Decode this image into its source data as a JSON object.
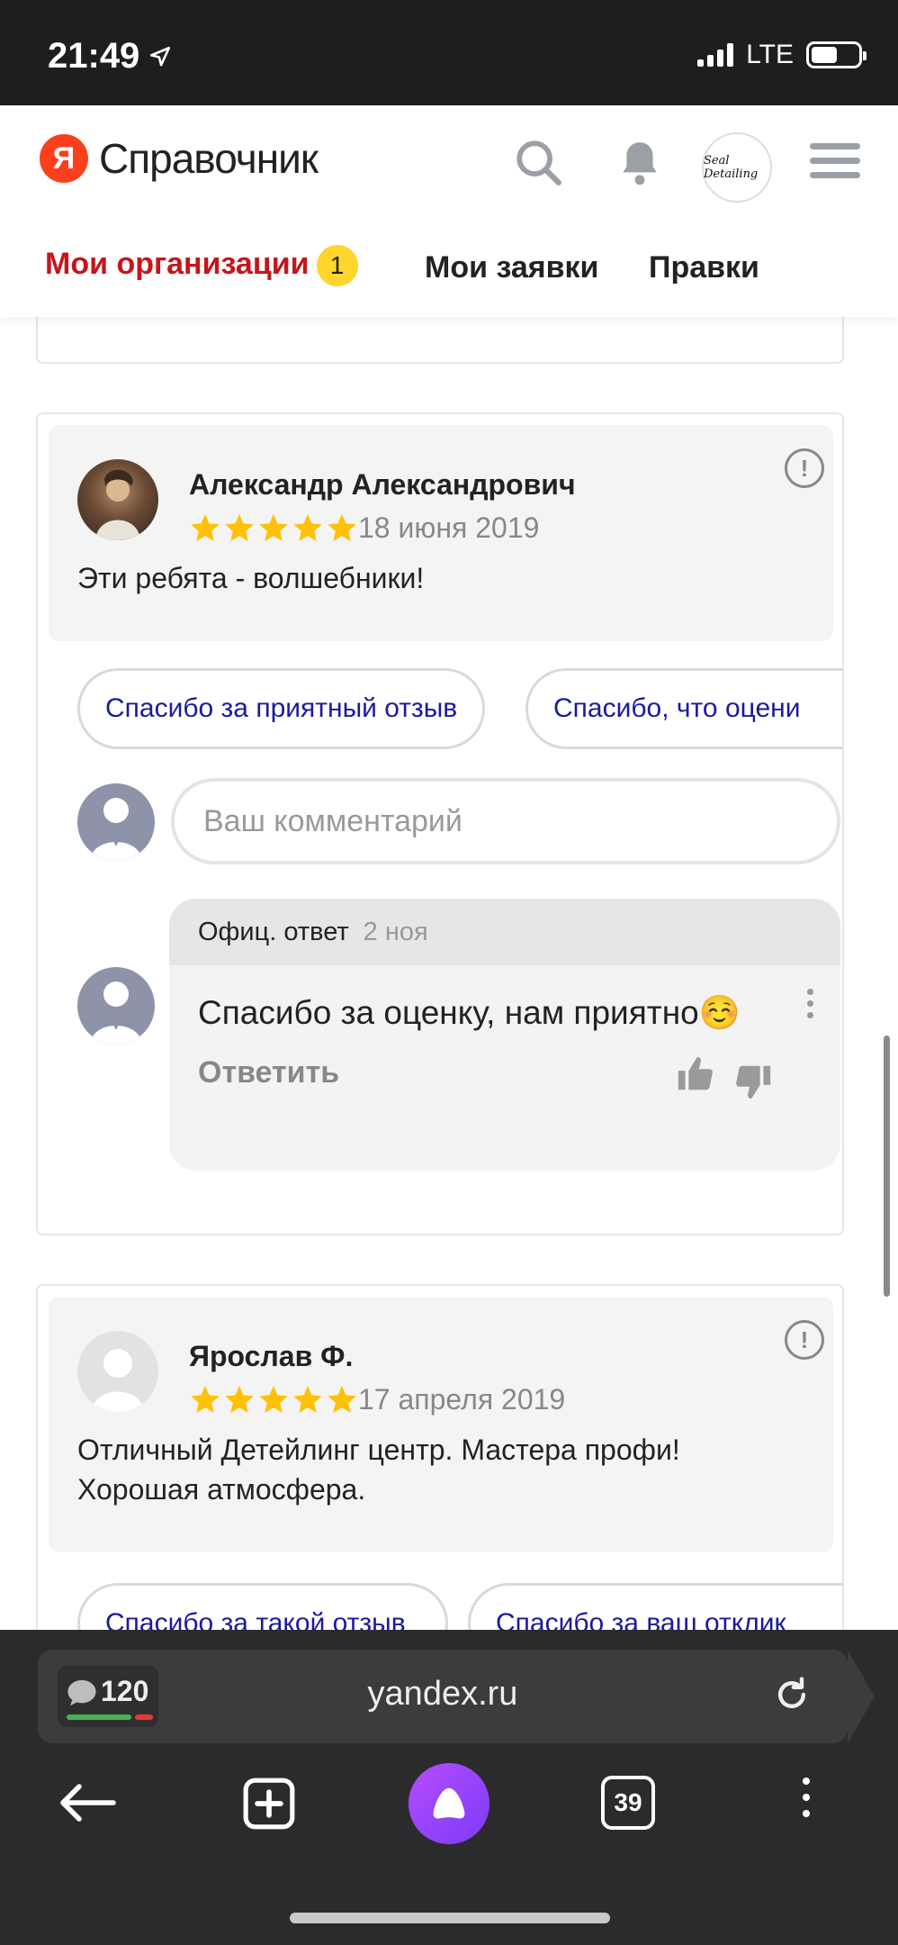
{
  "status_bar": {
    "time": "21:49",
    "network": "LTE"
  },
  "header": {
    "logo_letter": "Я",
    "logo_text": "Справочник",
    "org_logo_text": "Seal Detailing",
    "tabs": [
      {
        "label": "Мои организации",
        "badge": "1"
      },
      {
        "label": "Мои заявки"
      },
      {
        "label": "Правки"
      }
    ]
  },
  "reviews": [
    {
      "author": "Александр Александрович",
      "rating": 5,
      "date": "18 июня 2019",
      "text": "Эти ребята - волшебники!",
      "quick_replies": [
        "Спасибо за приятный отзыв",
        "Спасибо, что оцени"
      ],
      "comment_placeholder": "Ваш комментарий",
      "official_reply": {
        "label": "Офиц. ответ",
        "date": "2 ноя",
        "text": "Спасибо за оценку, нам приятно☺️",
        "reply_action": "Ответить"
      }
    },
    {
      "author": "Ярослав Ф.",
      "rating": 5,
      "date": "17 апреля 2019",
      "text": "Отличный Детейлинг центр. Мастера профи! Хорошая атмосфера.",
      "quick_replies": [
        "Спасибо за такой отзыв",
        "Спасибо за ваш отклик"
      ]
    }
  ],
  "browser": {
    "comments_count": "120",
    "url": "yandex.ru",
    "tabs_count": "39"
  },
  "colors": {
    "accent_red": "#c4161c",
    "badge_yellow": "#ffd52e",
    "star": "#ffc107",
    "chip_text": "#1a1a9e",
    "alice_purple": "#9b45ff"
  },
  "icons": [
    "search-icon",
    "bell-icon",
    "menu-icon",
    "report-icon",
    "like-icon",
    "dislike-icon",
    "back-icon",
    "new-tab-icon",
    "alice-icon",
    "more-icon",
    "reload-icon",
    "comment-icon",
    "location-arrow-icon"
  ]
}
